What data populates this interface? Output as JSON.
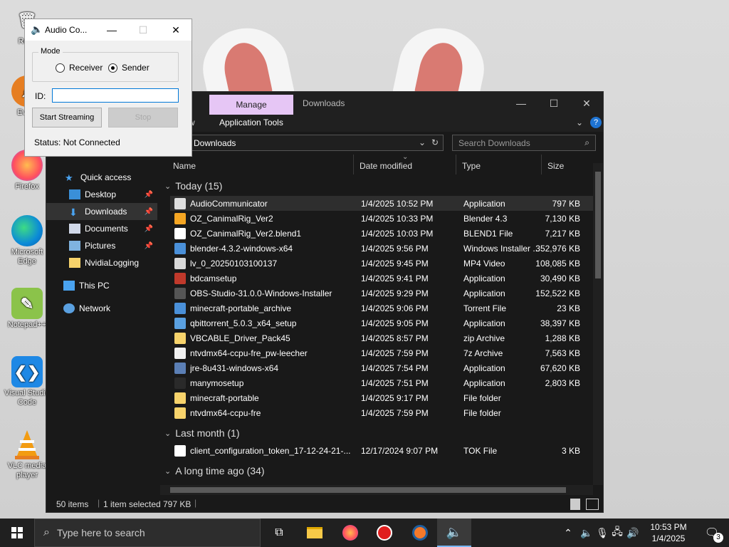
{
  "desktop": {
    "icons": [
      {
        "label": "Recy",
        "icon": "recycle-bin-icon"
      },
      {
        "label": "Every",
        "icon": "everything-search-icon"
      },
      {
        "label": "Firefox",
        "icon": "firefox-icon"
      },
      {
        "label": "Microsoft Edge",
        "icon": "edge-icon"
      },
      {
        "label": "Notepad++",
        "icon": "notepad-plus-icon"
      },
      {
        "label": "Visual Studio Code",
        "icon": "vscode-icon"
      },
      {
        "label": "VLC media player",
        "icon": "vlc-icon"
      }
    ]
  },
  "dialog": {
    "title": "Audio Co...",
    "mode_label": "Mode",
    "receiver_label": "Receiver",
    "sender_label": "Sender",
    "selected_mode": "Sender",
    "id_label": "ID:",
    "id_value": "",
    "start_label": "Start Streaming",
    "stop_label": "Stop",
    "status_text": "Status: Not Connected"
  },
  "explorer": {
    "title": "Downloads",
    "manage_tab": "Manage",
    "ribbon_fragment": "w",
    "app_tools_tab": "Application Tools",
    "address": "Downloads",
    "search_placeholder": "Search Downloads",
    "nav": [
      {
        "label": "Quick access",
        "icon": "star-icon",
        "pinned": false
      },
      {
        "label": "Desktop",
        "icon": "desktop-folder-icon",
        "pinned": true
      },
      {
        "label": "Downloads",
        "icon": "download-icon",
        "pinned": true,
        "selected": true
      },
      {
        "label": "Documents",
        "icon": "documents-icon",
        "pinned": true
      },
      {
        "label": "Pictures",
        "icon": "pictures-icon",
        "pinned": true
      },
      {
        "label": "NvidiaLogging",
        "icon": "folder-icon",
        "pinned": false
      },
      {
        "label": "This PC",
        "icon": "computer-icon",
        "pinned": false
      },
      {
        "label": "Network",
        "icon": "network-icon",
        "pinned": false
      }
    ],
    "columns": {
      "name": "Name",
      "date": "Date modified",
      "type": "Type",
      "size": "Size"
    },
    "groups": [
      {
        "label": "Today (15)",
        "rows": [
          {
            "name": "AudioCommunicator",
            "date": "1/4/2025 10:52 PM",
            "type": "Application",
            "size": "797 KB",
            "icon": "speaker-app-icon",
            "color": "#e0e0e0",
            "selected": true
          },
          {
            "name": "OZ_CanimalRig_Ver2",
            "date": "1/4/2025 10:33 PM",
            "type": "Blender 4.3",
            "size": "7,130 KB",
            "icon": "blender-icon",
            "color": "#f5a623"
          },
          {
            "name": "OZ_CanimalRig_Ver2.blend1",
            "date": "1/4/2025 10:03 PM",
            "type": "BLEND1 File",
            "size": "7,217 KB",
            "icon": "file-icon",
            "color": "#ffffff"
          },
          {
            "name": "blender-4.3.2-windows-x64",
            "date": "1/4/2025 9:56 PM",
            "type": "Windows Installer ...",
            "size": "352,976 KB",
            "icon": "installer-icon",
            "color": "#4a90d9"
          },
          {
            "name": "lv_0_20250103100137",
            "date": "1/4/2025 9:45 PM",
            "type": "MP4 Video",
            "size": "108,085 KB",
            "icon": "video-icon",
            "color": "#d9d9d9"
          },
          {
            "name": "bdcamsetup",
            "date": "1/4/2025 9:41 PM",
            "type": "Application",
            "size": "30,490 KB",
            "icon": "bandicam-icon",
            "color": "#c0392b"
          },
          {
            "name": "OBS-Studio-31.0.0-Windows-Installer",
            "date": "1/4/2025 9:29 PM",
            "type": "Application",
            "size": "152,522 KB",
            "icon": "obs-icon",
            "color": "#555555"
          },
          {
            "name": "minecraft-portable_archive",
            "date": "1/4/2025 9:06 PM",
            "type": "Torrent File",
            "size": "23 KB",
            "icon": "torrent-icon",
            "color": "#4a90d9"
          },
          {
            "name": "qbittorrent_5.0.3_x64_setup",
            "date": "1/4/2025 9:05 PM",
            "type": "Application",
            "size": "38,397 KB",
            "icon": "qbittorrent-icon",
            "color": "#5aa0e0"
          },
          {
            "name": "VBCABLE_Driver_Pack45",
            "date": "1/4/2025 8:57 PM",
            "type": "zip Archive",
            "size": "1,288 KB",
            "icon": "zip-folder-icon",
            "color": "#f7d36b"
          },
          {
            "name": "ntvdmx64-ccpu-fre_pw-leecher",
            "date": "1/4/2025 7:59 PM",
            "type": "7z Archive",
            "size": "7,563 KB",
            "icon": "7z-archive-icon",
            "color": "#f0f0f0"
          },
          {
            "name": "jre-8u431-windows-x64",
            "date": "1/4/2025 7:54 PM",
            "type": "Application",
            "size": "67,620 KB",
            "icon": "java-installer-icon",
            "color": "#5b7fb5"
          },
          {
            "name": "manymosetup",
            "date": "1/4/2025 7:51 PM",
            "type": "Application",
            "size": "2,803 KB",
            "icon": "app-icon",
            "color": "#2a2a2a"
          },
          {
            "name": "minecraft-portable",
            "date": "1/4/2025 9:17 PM",
            "type": "File folder",
            "size": "",
            "icon": "folder-icon",
            "color": "#f7d36b"
          },
          {
            "name": "ntvdmx64-ccpu-fre",
            "date": "1/4/2025 7:59 PM",
            "type": "File folder",
            "size": "",
            "icon": "folder-icon",
            "color": "#f7d36b"
          }
        ]
      },
      {
        "label": "Last month (1)",
        "rows": [
          {
            "name": "client_configuration_token_17-12-24-21-...",
            "date": "12/17/2024 9:07 PM",
            "type": "TOK File",
            "size": "3 KB",
            "icon": "file-icon",
            "color": "#ffffff"
          }
        ]
      },
      {
        "label": "A long time ago (34)",
        "rows": []
      }
    ],
    "status": {
      "items": "50 items",
      "selected": "1 item selected",
      "size": "797 KB"
    }
  },
  "taskbar": {
    "search_placeholder": "Type here to search",
    "apps": [
      "task-view-icon",
      "file-explorer-icon",
      "firefox-icon",
      "record-icon",
      "blender-icon",
      "speaker-app-icon"
    ],
    "time": "10:53 PM",
    "date": "1/4/2025",
    "notifications": "3"
  },
  "colors": {
    "accent": "#e6c6f5",
    "explorer_bg": "#191919",
    "taskbar_bg": "#202020"
  }
}
